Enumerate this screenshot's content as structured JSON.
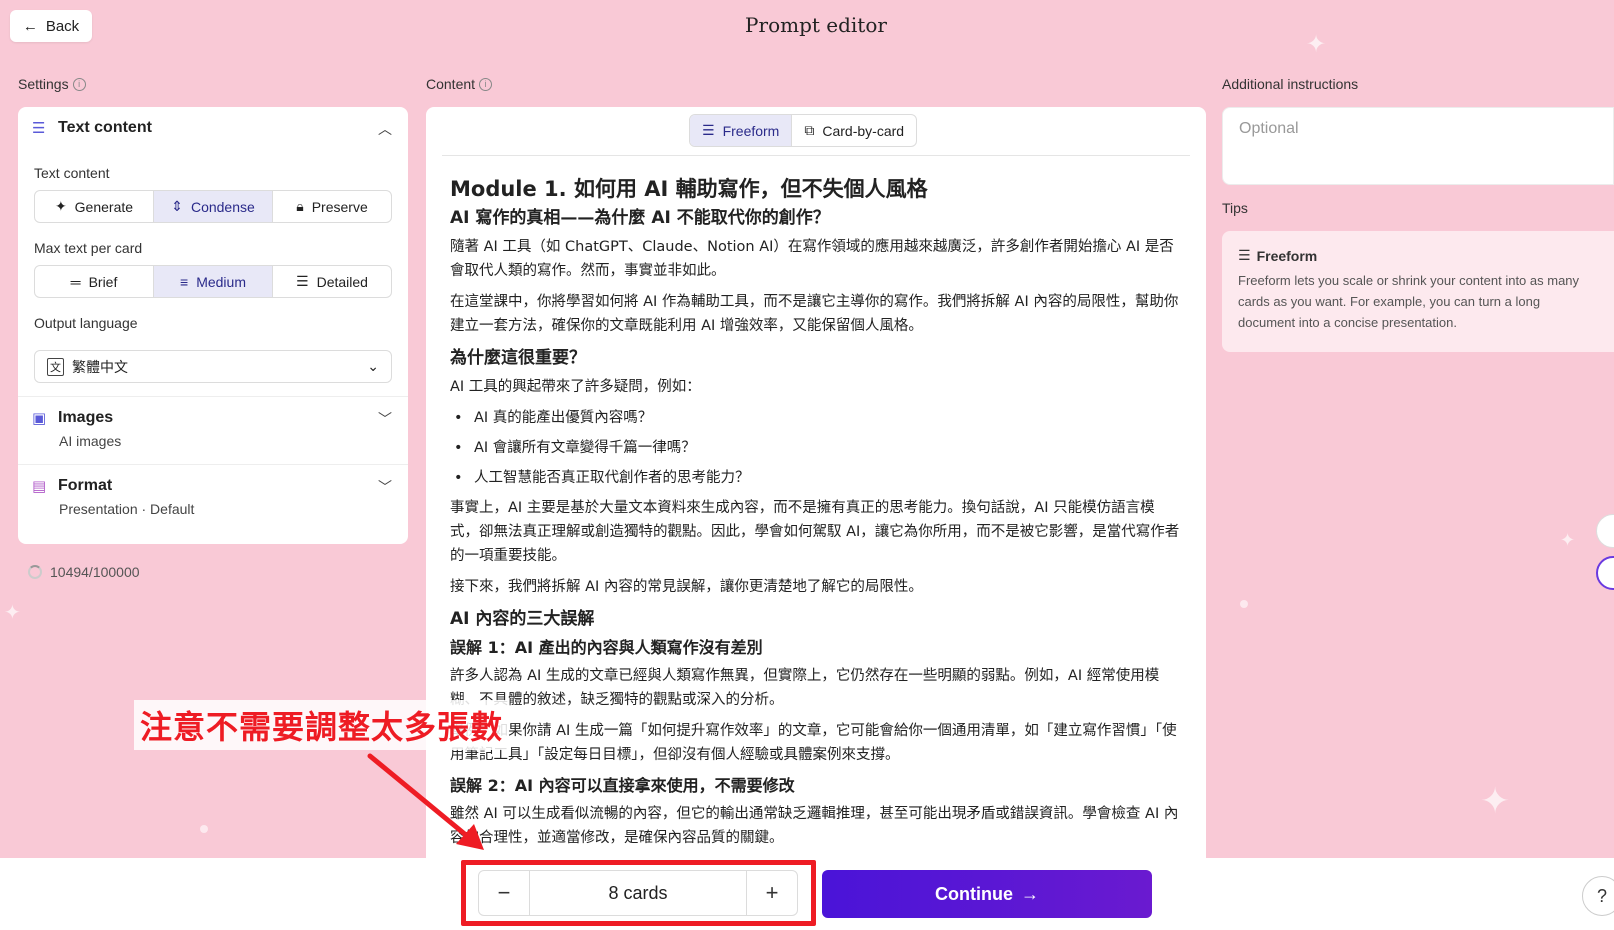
{
  "header": {
    "back_label": "Back",
    "title": "Prompt editor"
  },
  "settings": {
    "section_label": "Settings",
    "text_content": {
      "title": "Text content",
      "field_label": "Text content",
      "options": [
        "Generate",
        "Condense",
        "Preserve"
      ],
      "selected": "Condense",
      "max_label": "Max text per card",
      "max_options": [
        "Brief",
        "Medium",
        "Detailed"
      ],
      "max_selected": "Medium",
      "lang_label": "Output language",
      "lang_value": "繁體中文"
    },
    "images": {
      "title": "Images",
      "subtitle": "AI images"
    },
    "format": {
      "title": "Format",
      "subtitle": "Presentation · Default"
    },
    "credits": "10494/100000"
  },
  "content": {
    "section_label": "Content",
    "tabs": [
      "Freeform",
      "Card-by-card"
    ],
    "active_tab": "Freeform",
    "h1": "Module 1. 如何用 AI 輔助寫作，但不失個人風格",
    "h2a": "AI 寫作的真相——為什麼 AI 不能取代你的創作？",
    "p1": "隨著 AI 工具（如 ChatGPT、Claude、Notion AI）在寫作領域的應用越來越廣泛，許多創作者開始擔心 AI 是否會取代人類的寫作。然而，事實並非如此。",
    "p2": "在這堂課中，你將學習如何將 AI 作為輔助工具，而不是讓它主導你的寫作。我們將拆解 AI 內容的局限性，幫助你建立一套方法，確保你的文章既能利用 AI 增強效率，又能保留個人風格。",
    "h2b": "為什麼這很重要？",
    "p3": "AI 工具的興起帶來了許多疑問，例如：",
    "bullets": [
      "AI 真的能產出優質內容嗎？",
      "AI 會讓所有文章變得千篇一律嗎？",
      "人工智慧能否真正取代創作者的思考能力？"
    ],
    "p4": "事實上，AI 主要是基於大量文本資料來生成內容，而不是擁有真正的思考能力。換句話說，AI 只能模仿語言模式，卻無法真正理解或創造獨特的觀點。因此，學會如何駕馭 AI，讓它為你所用，而不是被它影響，是當代寫作者的一項重要技能。",
    "p5": "接下來，我們將拆解 AI 內容的常見誤解，讓你更清楚地了解它的局限性。",
    "h2c": "AI 內容的三大誤解",
    "h3a": "誤解 1：AI 產出的內容與人類寫作沒有差別",
    "p6": "許多人認為 AI 生成的文章已經與人類寫作無異，但實際上，它仍然存在一些明顯的弱點。例如，AI 經常使用模糊、不具體的敘述，缺乏獨特的觀點或深入的分析。",
    "p7": "舉例：如果你請 AI 生成一篇「如何提升寫作效率」的文章，它可能會給你一個通用清單，如「建立寫作習慣」「使用筆記工具」「設定每日目標」，但卻沒有個人經驗或具體案例來支撐。",
    "h3b": "誤解 2：AI 內容可以直接拿來使用，不需要修改",
    "p8": "雖然 AI 可以生成看似流暢的內容，但它的輸出通常缺乏邏輯推理，甚至可能出現矛盾或錯誤資訊。學會檢查 AI 內容的合理性，並適當修改，是確保內容品質的關鍵。"
  },
  "additional": {
    "section_label": "Additional instructions",
    "placeholder": "Optional",
    "tips_label": "Tips",
    "tips_title": "Freeform",
    "tips_text": "Freeform lets you scale or shrink your content into as many cards as you want. For example, you can turn a long document into a concise presentation."
  },
  "bottom": {
    "cards_value": "8 cards",
    "minus": "−",
    "plus": "+",
    "continue_label": "Continue",
    "help": "?"
  },
  "annotation": {
    "text": "注意不需要調整太多張數"
  },
  "colors": {
    "background": "#f9c9d6",
    "accent": "#4a14d8",
    "annotation_red": "#ee1c24"
  }
}
